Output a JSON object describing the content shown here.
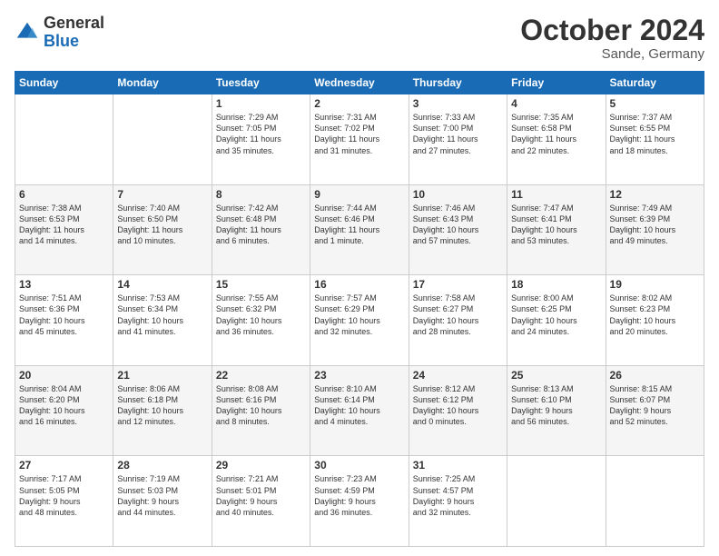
{
  "header": {
    "logo_general": "General",
    "logo_blue": "Blue",
    "month_title": "October 2024",
    "location": "Sande, Germany"
  },
  "weekdays": [
    "Sunday",
    "Monday",
    "Tuesday",
    "Wednesday",
    "Thursday",
    "Friday",
    "Saturday"
  ],
  "weeks": [
    [
      {
        "day": "",
        "info": ""
      },
      {
        "day": "",
        "info": ""
      },
      {
        "day": "1",
        "info": "Sunrise: 7:29 AM\nSunset: 7:05 PM\nDaylight: 11 hours\nand 35 minutes."
      },
      {
        "day": "2",
        "info": "Sunrise: 7:31 AM\nSunset: 7:02 PM\nDaylight: 11 hours\nand 31 minutes."
      },
      {
        "day": "3",
        "info": "Sunrise: 7:33 AM\nSunset: 7:00 PM\nDaylight: 11 hours\nand 27 minutes."
      },
      {
        "day": "4",
        "info": "Sunrise: 7:35 AM\nSunset: 6:58 PM\nDaylight: 11 hours\nand 22 minutes."
      },
      {
        "day": "5",
        "info": "Sunrise: 7:37 AM\nSunset: 6:55 PM\nDaylight: 11 hours\nand 18 minutes."
      }
    ],
    [
      {
        "day": "6",
        "info": "Sunrise: 7:38 AM\nSunset: 6:53 PM\nDaylight: 11 hours\nand 14 minutes."
      },
      {
        "day": "7",
        "info": "Sunrise: 7:40 AM\nSunset: 6:50 PM\nDaylight: 11 hours\nand 10 minutes."
      },
      {
        "day": "8",
        "info": "Sunrise: 7:42 AM\nSunset: 6:48 PM\nDaylight: 11 hours\nand 6 minutes."
      },
      {
        "day": "9",
        "info": "Sunrise: 7:44 AM\nSunset: 6:46 PM\nDaylight: 11 hours\nand 1 minute."
      },
      {
        "day": "10",
        "info": "Sunrise: 7:46 AM\nSunset: 6:43 PM\nDaylight: 10 hours\nand 57 minutes."
      },
      {
        "day": "11",
        "info": "Sunrise: 7:47 AM\nSunset: 6:41 PM\nDaylight: 10 hours\nand 53 minutes."
      },
      {
        "day": "12",
        "info": "Sunrise: 7:49 AM\nSunset: 6:39 PM\nDaylight: 10 hours\nand 49 minutes."
      }
    ],
    [
      {
        "day": "13",
        "info": "Sunrise: 7:51 AM\nSunset: 6:36 PM\nDaylight: 10 hours\nand 45 minutes."
      },
      {
        "day": "14",
        "info": "Sunrise: 7:53 AM\nSunset: 6:34 PM\nDaylight: 10 hours\nand 41 minutes."
      },
      {
        "day": "15",
        "info": "Sunrise: 7:55 AM\nSunset: 6:32 PM\nDaylight: 10 hours\nand 36 minutes."
      },
      {
        "day": "16",
        "info": "Sunrise: 7:57 AM\nSunset: 6:29 PM\nDaylight: 10 hours\nand 32 minutes."
      },
      {
        "day": "17",
        "info": "Sunrise: 7:58 AM\nSunset: 6:27 PM\nDaylight: 10 hours\nand 28 minutes."
      },
      {
        "day": "18",
        "info": "Sunrise: 8:00 AM\nSunset: 6:25 PM\nDaylight: 10 hours\nand 24 minutes."
      },
      {
        "day": "19",
        "info": "Sunrise: 8:02 AM\nSunset: 6:23 PM\nDaylight: 10 hours\nand 20 minutes."
      }
    ],
    [
      {
        "day": "20",
        "info": "Sunrise: 8:04 AM\nSunset: 6:20 PM\nDaylight: 10 hours\nand 16 minutes."
      },
      {
        "day": "21",
        "info": "Sunrise: 8:06 AM\nSunset: 6:18 PM\nDaylight: 10 hours\nand 12 minutes."
      },
      {
        "day": "22",
        "info": "Sunrise: 8:08 AM\nSunset: 6:16 PM\nDaylight: 10 hours\nand 8 minutes."
      },
      {
        "day": "23",
        "info": "Sunrise: 8:10 AM\nSunset: 6:14 PM\nDaylight: 10 hours\nand 4 minutes."
      },
      {
        "day": "24",
        "info": "Sunrise: 8:12 AM\nSunset: 6:12 PM\nDaylight: 10 hours\nand 0 minutes."
      },
      {
        "day": "25",
        "info": "Sunrise: 8:13 AM\nSunset: 6:10 PM\nDaylight: 9 hours\nand 56 minutes."
      },
      {
        "day": "26",
        "info": "Sunrise: 8:15 AM\nSunset: 6:07 PM\nDaylight: 9 hours\nand 52 minutes."
      }
    ],
    [
      {
        "day": "27",
        "info": "Sunrise: 7:17 AM\nSunset: 5:05 PM\nDaylight: 9 hours\nand 48 minutes."
      },
      {
        "day": "28",
        "info": "Sunrise: 7:19 AM\nSunset: 5:03 PM\nDaylight: 9 hours\nand 44 minutes."
      },
      {
        "day": "29",
        "info": "Sunrise: 7:21 AM\nSunset: 5:01 PM\nDaylight: 9 hours\nand 40 minutes."
      },
      {
        "day": "30",
        "info": "Sunrise: 7:23 AM\nSunset: 4:59 PM\nDaylight: 9 hours\nand 36 minutes."
      },
      {
        "day": "31",
        "info": "Sunrise: 7:25 AM\nSunset: 4:57 PM\nDaylight: 9 hours\nand 32 minutes."
      },
      {
        "day": "",
        "info": ""
      },
      {
        "day": "",
        "info": ""
      }
    ]
  ]
}
